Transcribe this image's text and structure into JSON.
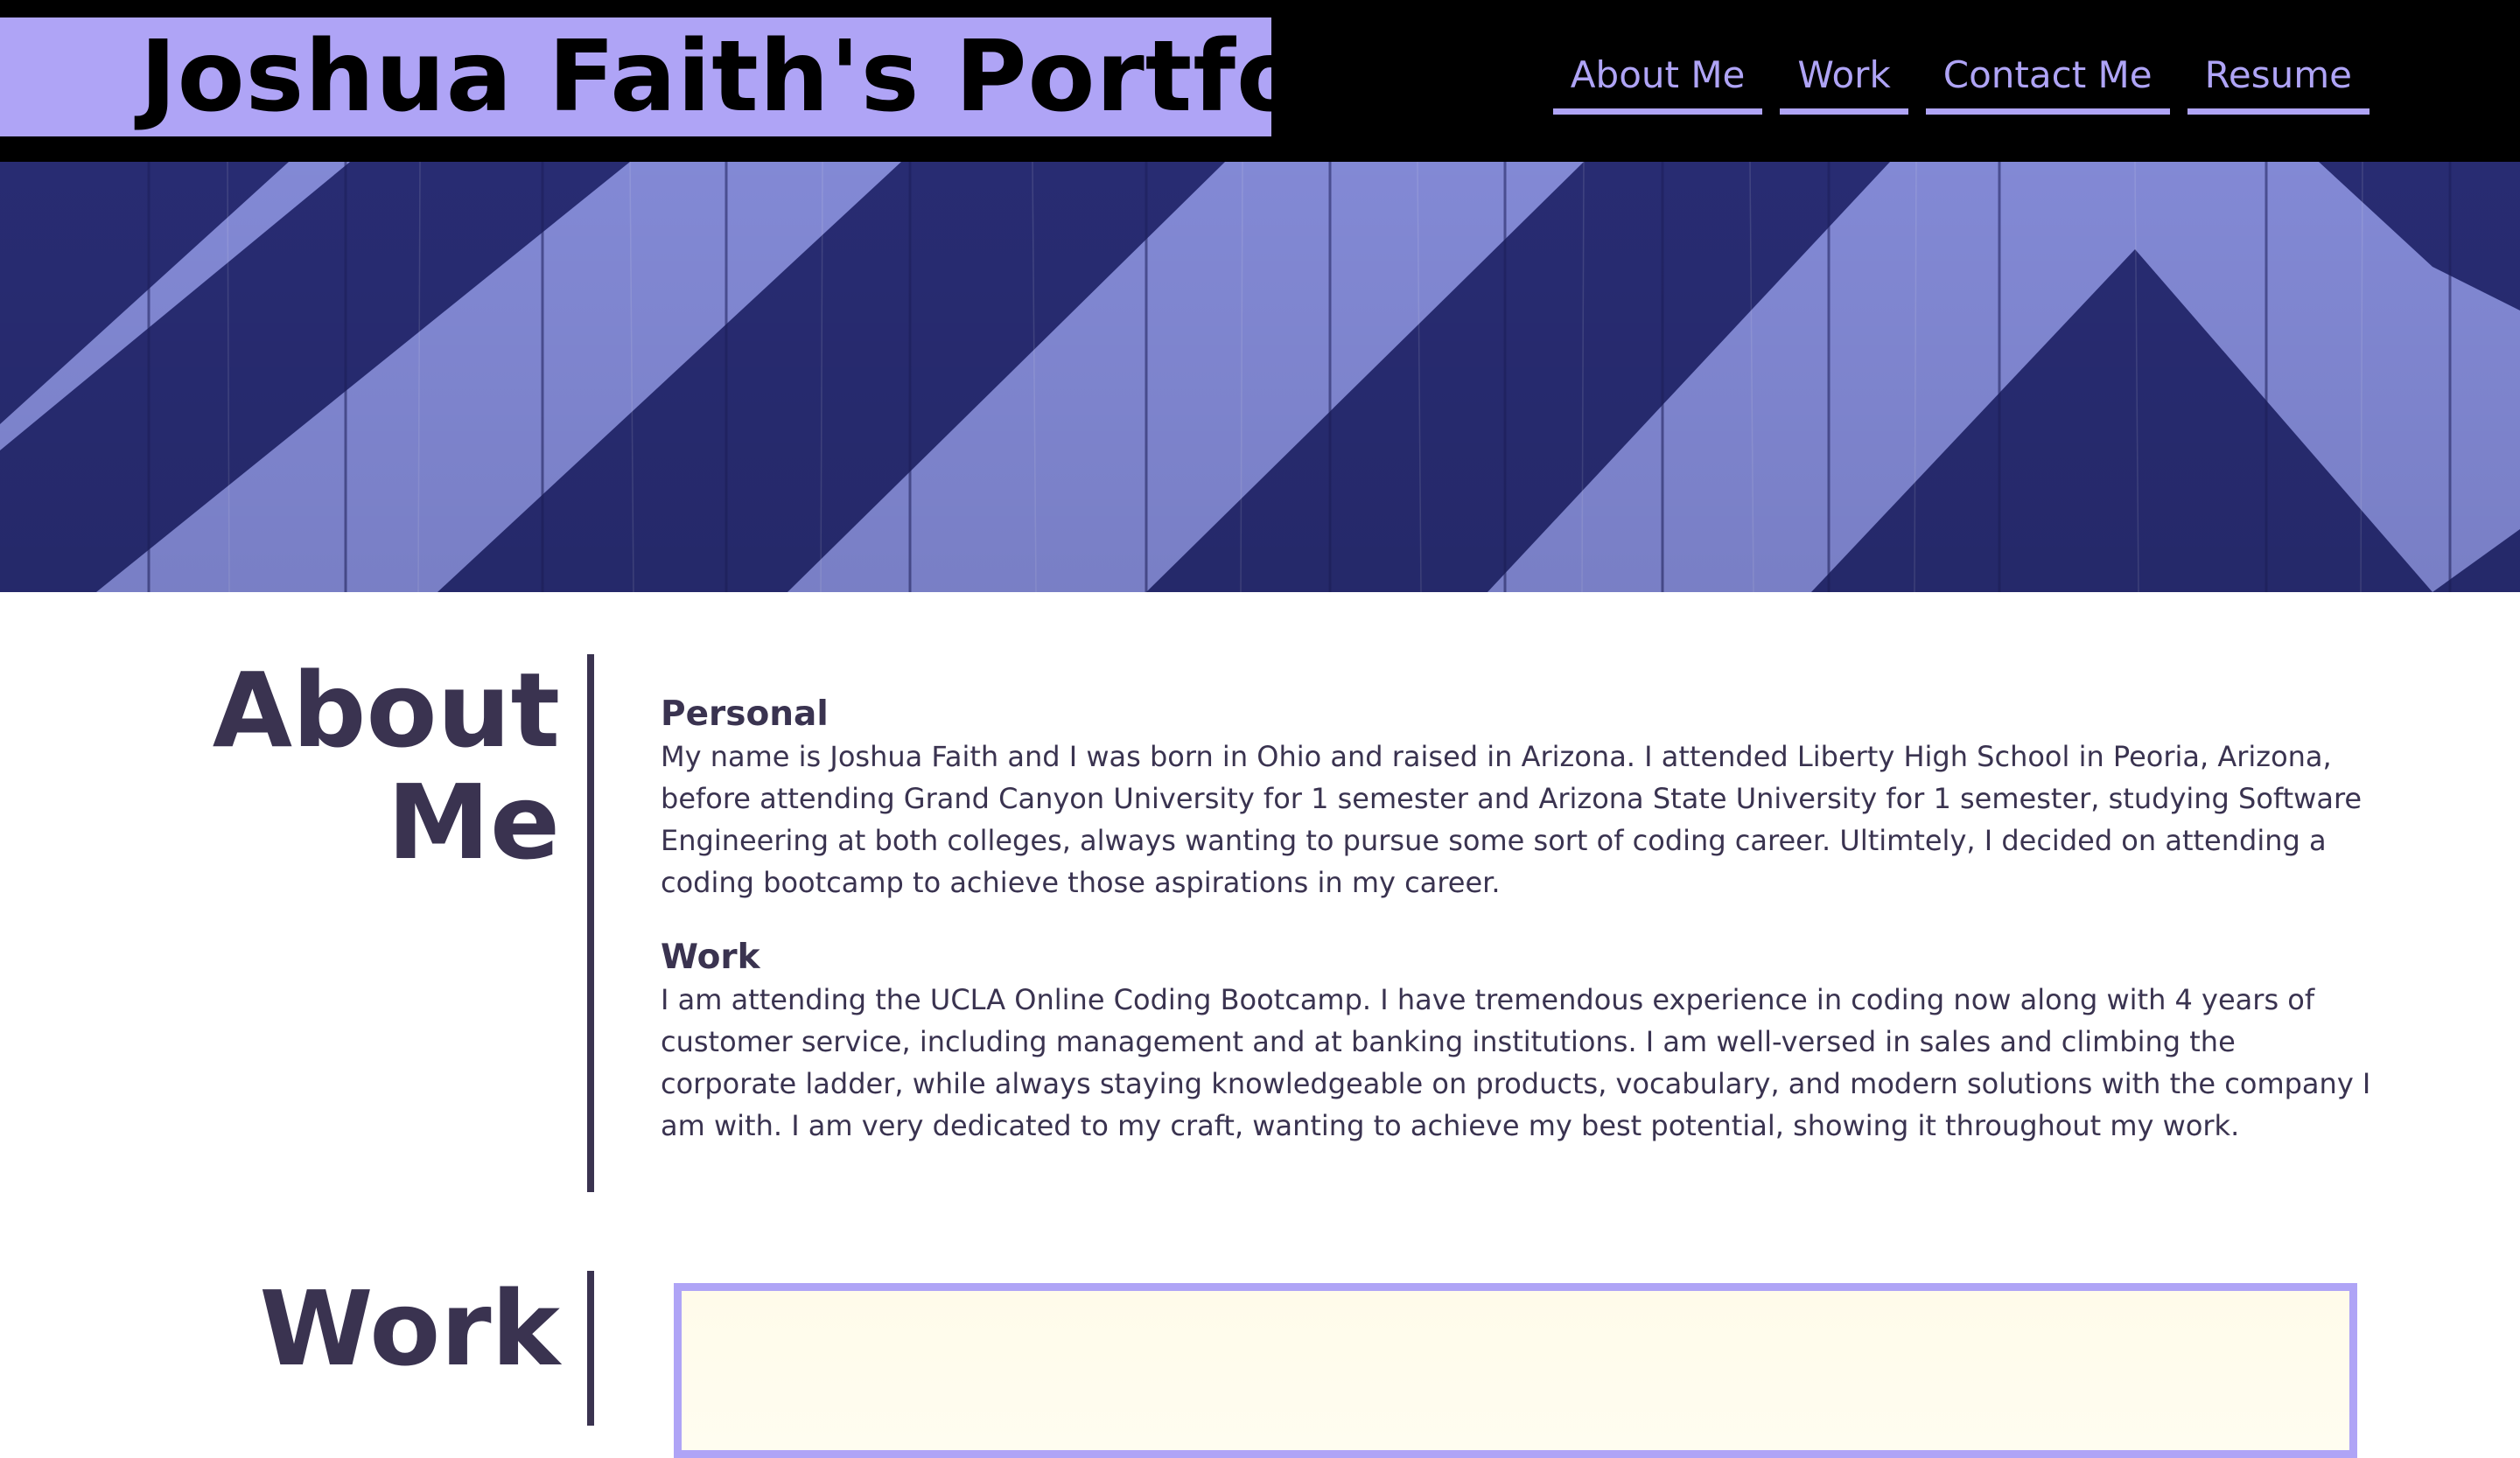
{
  "header": {
    "title": "Joshua Faith's Portfolio",
    "nav": [
      {
        "label": "About Me"
      },
      {
        "label": "Work"
      },
      {
        "label": "Contact Me"
      },
      {
        "label": "Resume"
      }
    ]
  },
  "about": {
    "heading_line1": "About",
    "heading_line2": "Me",
    "personal_title": "Personal",
    "personal_text": "My name is Joshua Faith and I was born in Ohio and raised in Arizona. I attended Liberty High School in Peoria, Arizona, before attending Grand Canyon University for 1 semester and Arizona State University for 1 semester, studying Software Engineering at both colleges, always wanting to pursue some sort of coding career. Ultimtely, I decided on attending a coding bootcamp to achieve those aspirations in my career.",
    "work_title": "Work",
    "work_text": "I am attending the UCLA Online Coding Bootcamp. I have tremendous experience in coding now along with 4 years of customer service, including management and at banking institutions. I am well-versed in sales and climbing the corporate ladder, while always staying knowledgeable on products, vocabulary, and modern solutions with the company I am with. I am very dedicated to my craft, wanting to achieve my best potential, showing it throughout my work."
  },
  "work": {
    "heading": "Work"
  },
  "colors": {
    "header_bg": "#000000",
    "accent": "#afa4f6",
    "text": "#3a3350",
    "hero_light": "#8990e0",
    "hero_dark": "#2a2e78"
  }
}
